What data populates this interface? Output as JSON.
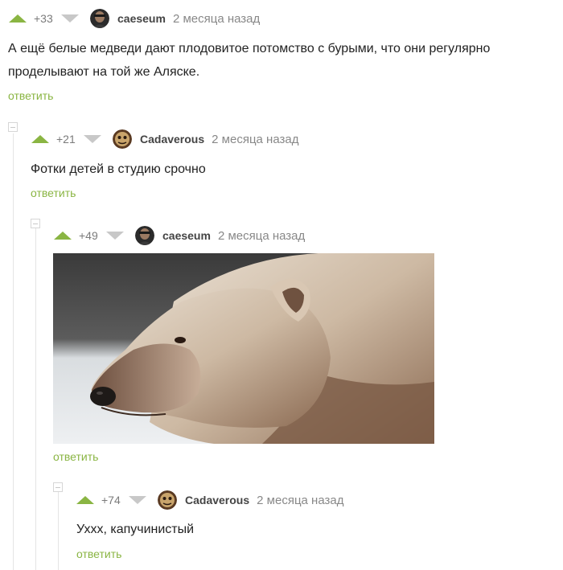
{
  "comments": [
    {
      "score": "+33",
      "author": "caeseum",
      "time": "2 месяца назад",
      "text_lines": [
        "А ещё белые медведи дают плодовитое потомство с бурыми, что они регулярно",
        "проделывают на той же Аляске."
      ],
      "reply_label": "ответить"
    },
    {
      "score": "+21",
      "author": "Cadaverous",
      "time": "2 месяца назад",
      "text_lines": [
        "Фотки детей в студию срочно"
      ],
      "reply_label": "ответить"
    },
    {
      "score": "+49",
      "author": "caeseum",
      "time": "2 месяца назад",
      "image": "photo of a pizzly bear head (polar-grizzly hybrid)",
      "reply_label": "ответить"
    },
    {
      "score": "+74",
      "author": "Cadaverous",
      "time": "2 месяца назад",
      "text_lines": [
        "Уххх, капучинистый"
      ],
      "reply_label": "ответить"
    }
  ],
  "colors": {
    "accent_green": "#8ab543",
    "downvote_grey": "#c8c8c8",
    "meta_grey": "#888888"
  },
  "icons": [
    "upvote-icon",
    "downvote-icon",
    "collapse-icon"
  ]
}
